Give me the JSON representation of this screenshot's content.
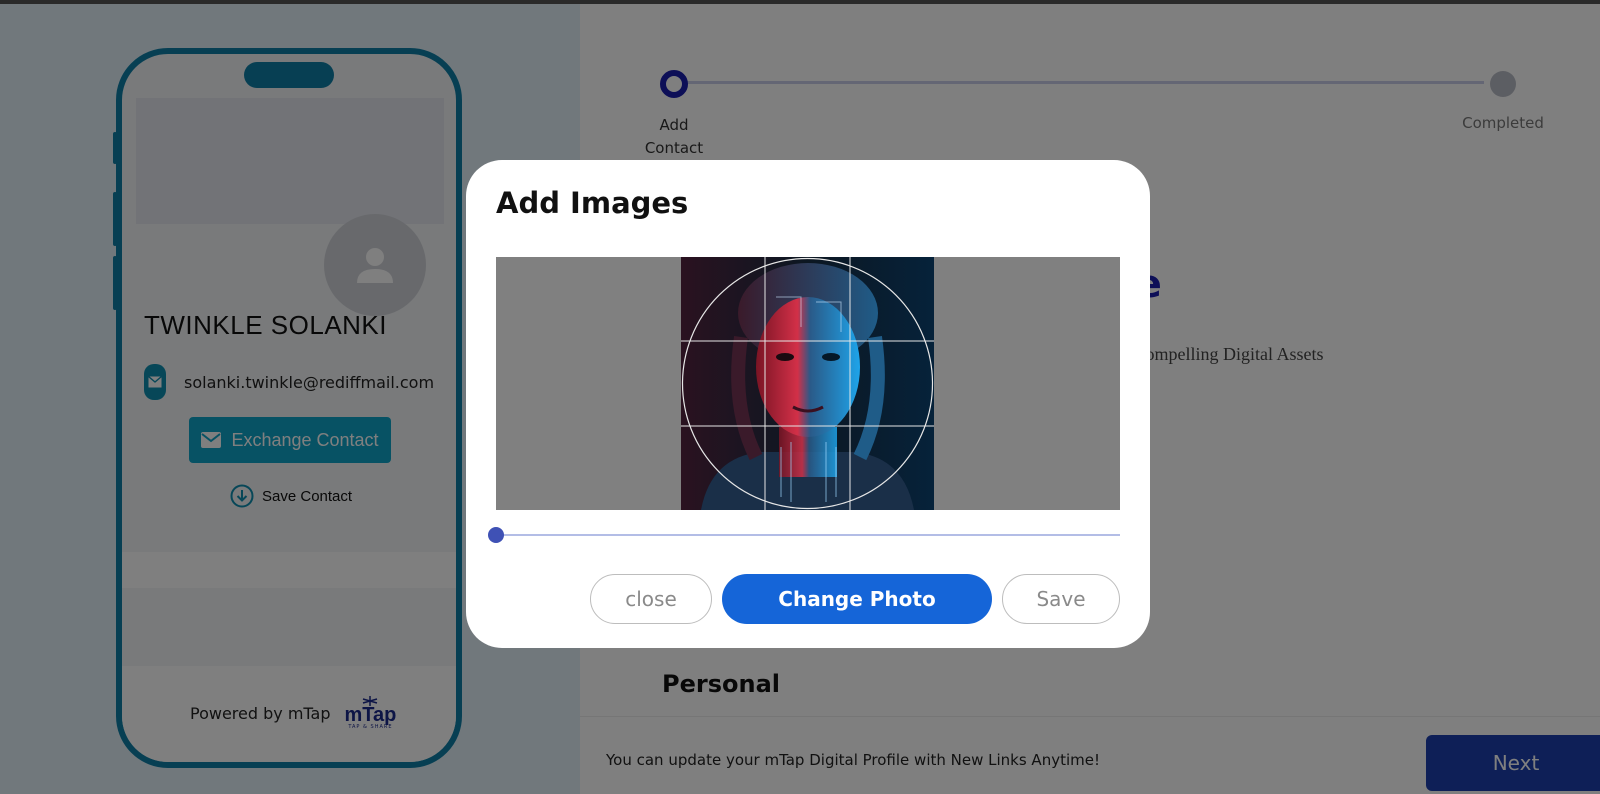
{
  "card": {
    "name": "TWINKLE SOLANKI",
    "email": "solanki.twinkle@rediffmail.com",
    "exchange_label": "Exchange Contact",
    "save_label": "Save Contact",
    "powered_by": "Powered by mTap",
    "logo_word": "mTap",
    "logo_tagline": "TAP & SHARE",
    "accent_color": "#0ea5c8"
  },
  "stepper": {
    "steps": [
      {
        "label": "Add Contact",
        "state": "active"
      },
      {
        "label": "Completed",
        "state": "inactive"
      }
    ]
  },
  "main": {
    "headline_fragment": "rofile",
    "subtitle_fragment": "ost Compelling Digital Assets",
    "section_title": "Personal",
    "footer_note": "You can update your mTap Digital Profile with New Links Anytime!",
    "next_label": "Next",
    "brand_color": "#1b1fae"
  },
  "modal": {
    "title": "Add Images",
    "zoom_value": 0,
    "close_label": "close",
    "change_label": "Change Photo",
    "save_label": "Save",
    "primary_color": "#1565d8"
  }
}
